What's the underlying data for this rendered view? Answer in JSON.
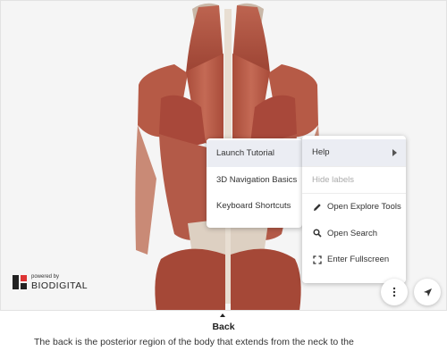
{
  "context_menu": {
    "items": [
      {
        "label": "Launch Tutorial"
      },
      {
        "label": "3D Navigation Basics"
      },
      {
        "label": "Keyboard Shortcuts"
      }
    ]
  },
  "help_menu": {
    "help": "Help",
    "hide_labels": "Hide labels",
    "explore_tools": "Open Explore Tools",
    "search": "Open Search",
    "fullscreen": "Enter Fullscreen"
  },
  "branding": {
    "powered_by": "powered by",
    "name": "BIODIGITAL"
  },
  "panel": {
    "title": "Back",
    "description": "The back is the posterior region of the body that extends from the neck to the"
  },
  "icons": {
    "more": "more-vertical-icon",
    "navigate": "navigation-arrow-icon",
    "pencil": "pencil-icon",
    "search": "search-icon",
    "fullscreen": "fullscreen-icon",
    "expand": "caret-up-icon"
  },
  "colors": {
    "muscle": "#b5533f",
    "muscle_dark": "#8c3a2c",
    "tendon": "#e6ddd0",
    "menu_active": "#ebedf3"
  }
}
